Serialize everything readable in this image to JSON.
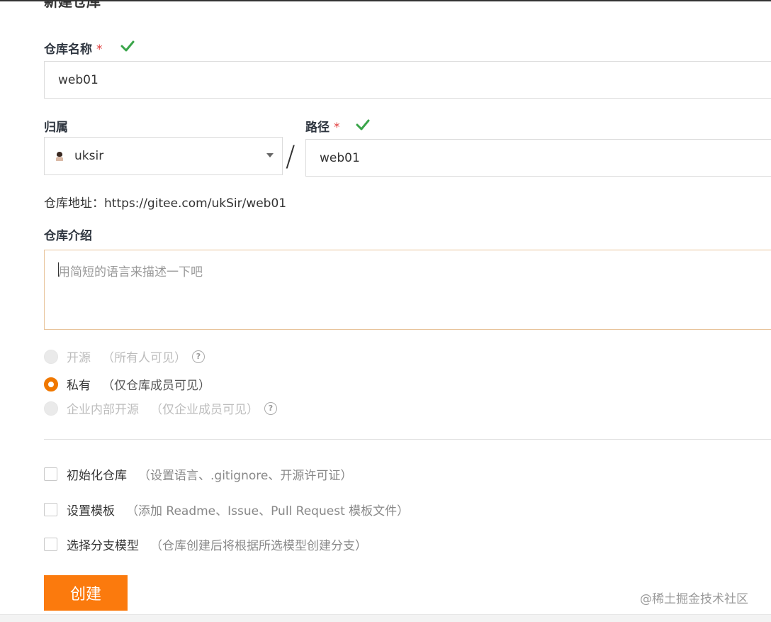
{
  "page": {
    "cut_title": "新建仓库"
  },
  "form": {
    "repo_name": {
      "label": "仓库名称",
      "required_mark": "*",
      "value": "web01"
    },
    "owner": {
      "label": "归属",
      "value": "uksir"
    },
    "separator": "/",
    "path": {
      "label": "路径",
      "required_mark": "*",
      "value": "web01"
    },
    "address": "仓库地址：https://gitee.com/ukSir/web01",
    "intro": {
      "label": "仓库介绍",
      "placeholder": "用简短的语言来描述一下吧"
    },
    "visibility": [
      {
        "label": "开源",
        "note": "（所有人可见）",
        "state": "disabled",
        "help": "?"
      },
      {
        "label": "私有",
        "note": "（仅仓库成员可见）",
        "state": "selected"
      },
      {
        "label": "企业内部开源",
        "note": "（仅企业成员可见）",
        "state": "disabled",
        "help": "?"
      }
    ],
    "options": [
      {
        "label": "初始化仓库",
        "note": "（设置语言、.gitignore、开源许可证）",
        "checked": false
      },
      {
        "label": "设置模板",
        "note": "（添加 Readme、Issue、Pull Request 模板文件）",
        "checked": false
      },
      {
        "label": "选择分支模型",
        "note": "（仓库创建后将根据所选模型创建分支）",
        "checked": false
      }
    ],
    "submit_label": "创建"
  },
  "watermark": "@稀土掘金技术社区",
  "colors": {
    "accent": "#fb7a0d",
    "check_green": "#3aa54a",
    "required_red": "#e03b3b"
  },
  "icons": {
    "valid": "check-icon",
    "help": "question-circle-icon",
    "dropdown": "caret-down-icon"
  }
}
